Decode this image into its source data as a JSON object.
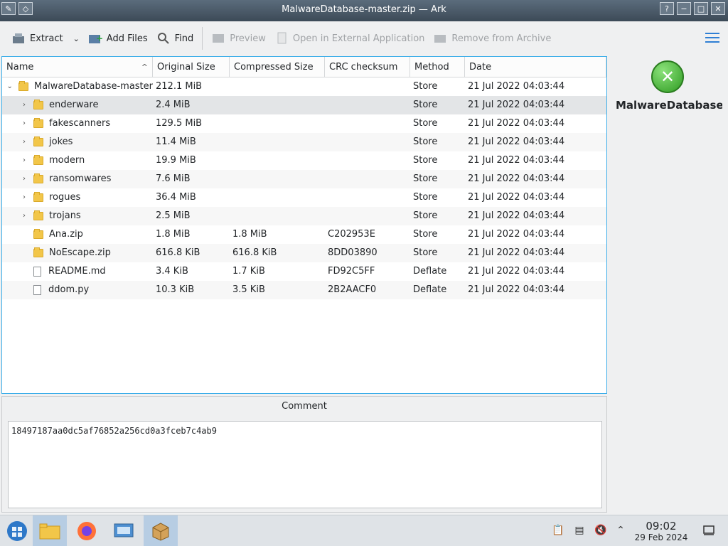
{
  "window": {
    "title": "MalwareDatabase-master.zip — Ark"
  },
  "toolbar": {
    "extract": "Extract",
    "add_files": "Add Files",
    "find": "Find",
    "preview": "Preview",
    "open_external": "Open in External Application",
    "remove": "Remove from Archive"
  },
  "columns": [
    "Name",
    "Original Size",
    "Compressed Size",
    "CRC checksum",
    "Method",
    "Date"
  ],
  "rows": [
    {
      "name": "MalwareDatabase-master",
      "orig": "212.1 MiB",
      "comp": "",
      "crc": "",
      "method": "Store",
      "date": "21 Jul 2022 04:03:44"
    },
    {
      "name": "enderware",
      "orig": "2.4 MiB",
      "comp": "",
      "crc": "",
      "method": "Store",
      "date": "21 Jul 2022 04:03:44"
    },
    {
      "name": "fakescanners",
      "orig": "129.5 MiB",
      "comp": "",
      "crc": "",
      "method": "Store",
      "date": "21 Jul 2022 04:03:44"
    },
    {
      "name": "jokes",
      "orig": "11.4 MiB",
      "comp": "",
      "crc": "",
      "method": "Store",
      "date": "21 Jul 2022 04:03:44"
    },
    {
      "name": "modern",
      "orig": "19.9 MiB",
      "comp": "",
      "crc": "",
      "method": "Store",
      "date": "21 Jul 2022 04:03:44"
    },
    {
      "name": "ransomwares",
      "orig": "7.6 MiB",
      "comp": "",
      "crc": "",
      "method": "Store",
      "date": "21 Jul 2022 04:03:44"
    },
    {
      "name": "rogues",
      "orig": "36.4 MiB",
      "comp": "",
      "crc": "",
      "method": "Store",
      "date": "21 Jul 2022 04:03:44"
    },
    {
      "name": "trojans",
      "orig": "2.5 MiB",
      "comp": "",
      "crc": "",
      "method": "Store",
      "date": "21 Jul 2022 04:03:44"
    },
    {
      "name": "Ana.zip",
      "orig": "1.8 MiB",
      "comp": "1.8 MiB",
      "crc": "C202953E",
      "method": "Store",
      "date": "21 Jul 2022 04:03:44"
    },
    {
      "name": "NoEscape.zip",
      "orig": "616.8 KiB",
      "comp": "616.8 KiB",
      "crc": "8DD03890",
      "method": "Store",
      "date": "21 Jul 2022 04:03:44"
    },
    {
      "name": "README.md",
      "orig": "3.4 KiB",
      "comp": "1.7 KiB",
      "crc": "FD92C5FF",
      "method": "Deflate",
      "date": "21 Jul 2022 04:03:44"
    },
    {
      "name": "ddom.py",
      "orig": "10.3 KiB",
      "comp": "3.5 KiB",
      "crc": "2B2AACF0",
      "method": "Deflate",
      "date": "21 Jul 2022 04:03:44"
    }
  ],
  "info_panel": {
    "title": "MalwareDatabase..."
  },
  "comment": {
    "label": "Comment",
    "text": "18497187aa0dc5af76852a256cd0a3fceb7c4ab9"
  },
  "taskbar": {
    "time": "09:02",
    "date": "29 Feb 2024"
  }
}
